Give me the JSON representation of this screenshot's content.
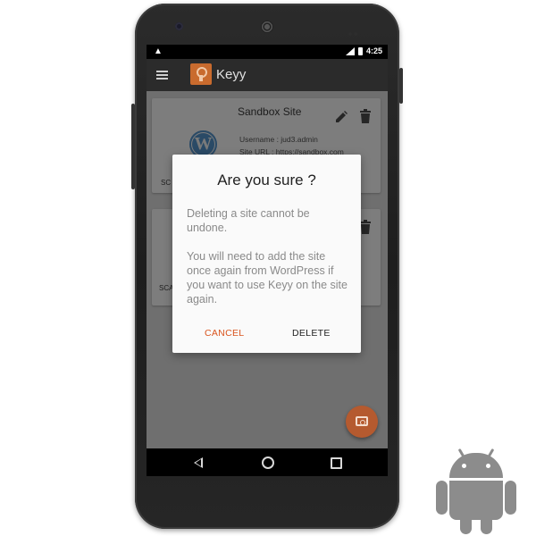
{
  "statusbar": {
    "time": "4:25",
    "android_icon": "android-notification-icon",
    "network_icon": "signal-icon",
    "battery_icon": "battery-icon"
  },
  "appbar": {
    "title": "Keyy",
    "menu_icon": "hamburger-menu-icon",
    "logo_icon": "keyy-keyhole-logo"
  },
  "sites": [
    {
      "name": "Sandbox Site",
      "username": "Username : jud3.admin",
      "url": "Site URL : https://sandbox.com",
      "scan_label": "SC",
      "logo_icon": "wordpress-icon"
    },
    {
      "name": "",
      "scan_label": "SCA"
    }
  ],
  "dialog": {
    "title": "Are you sure ?",
    "message_1": "Deleting a site cannot be undone.",
    "message_2": "You will need to add the site once again from WordPress if you want to use Keyy on the site again.",
    "cancel_label": "CANCEL",
    "delete_label": "DELETE"
  },
  "fab": {
    "icon": "add-photo-camera-icon"
  },
  "colors": {
    "accent": "#d9541e",
    "appbar": "#2b2b2b",
    "brand_logo": "#c96b2e"
  }
}
